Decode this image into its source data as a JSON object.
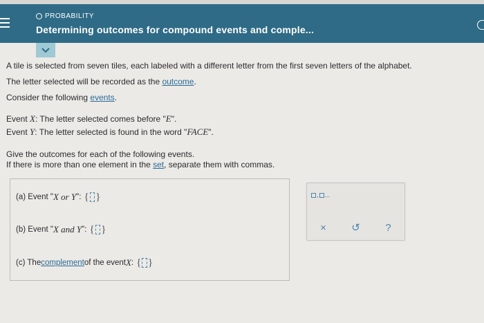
{
  "header": {
    "topic": "PROBABILITY",
    "title": "Determining outcomes for compound events and comple..."
  },
  "colors": {
    "header_bg": "#2f6b86",
    "link": "#2a6a96",
    "collapse_bg": "#9fc9d4"
  },
  "problem": {
    "intro": "A tile is selected from seven tiles, each labeled with a different letter from the first seven letters of the alphabet.",
    "outcome_pre": "The letter selected will be recorded as the ",
    "outcome_link": "outcome",
    "outcome_post": ".",
    "events_pre": "Consider the following ",
    "events_link": "events",
    "events_post": ".",
    "event_x_label": "Event ",
    "event_x_var": "X",
    "event_x_text": ": The letter selected comes before \"",
    "event_x_letter": "E",
    "event_x_end": "\".",
    "event_y_label": "Event ",
    "event_y_var": "Y",
    "event_y_text": ": The letter selected is found in the word \"",
    "event_y_word": "FACE",
    "event_y_end": "\".",
    "instr1": "Give the outcomes for each of the following events.",
    "instr2_pre": "If there is more than one element in the ",
    "instr2_link": "set",
    "instr2_post": ", separate them with commas."
  },
  "questions": {
    "a_pre": "(a)  Event \"",
    "a_math": "X or Y",
    "a_post": "\":",
    "b_pre": "(b)  Event \"",
    "b_math": "X and Y",
    "b_post": "\":",
    "c_pre": "(c)  The ",
    "c_link": "complement",
    "c_mid": " of the event ",
    "c_math": "X",
    "c_post": ":",
    "brace_open": "{",
    "brace_close": "}"
  },
  "toolbox": {
    "set_tool_suffix": "...",
    "clear": "×",
    "undo": "↺",
    "help": "?"
  }
}
